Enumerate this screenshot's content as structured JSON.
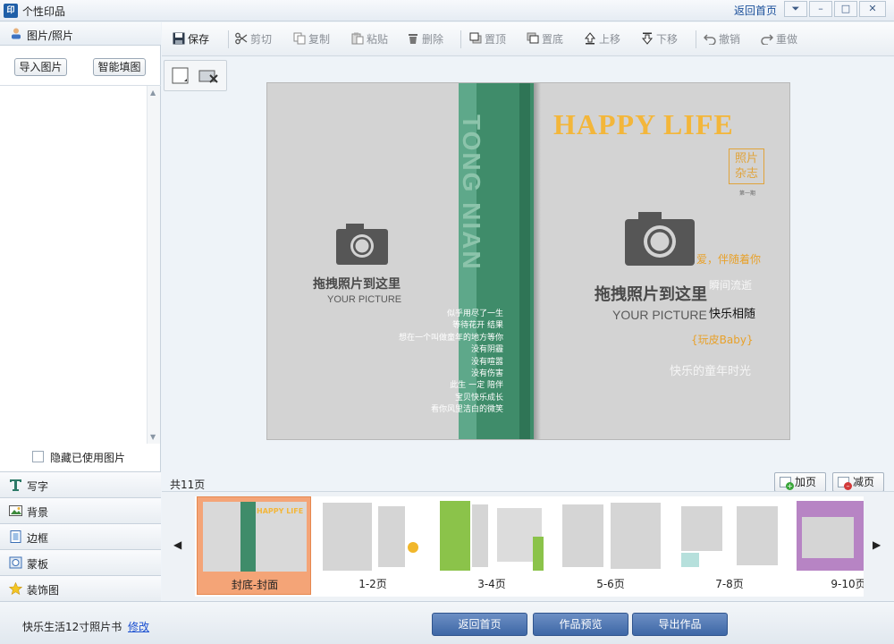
{
  "window": {
    "app_icon": "印",
    "title": "个性印品",
    "home_link": "返回首页",
    "controls": [
      "⏷",
      "–",
      "□",
      "✕"
    ]
  },
  "left_panel": {
    "header": "图片/照片",
    "import_button": "导入图片",
    "smart_fill_button": "智能填图",
    "hide_used_label": "隐藏已使用图片",
    "categories": [
      {
        "icon": "text-icon",
        "label": "写字"
      },
      {
        "icon": "background-icon",
        "label": "背景"
      },
      {
        "icon": "frame-icon",
        "label": "边框"
      },
      {
        "icon": "mask-icon",
        "label": "蒙板"
      },
      {
        "icon": "star-icon",
        "label": "装饰图"
      }
    ]
  },
  "toolbar": {
    "save": "保存",
    "cut": "剪切",
    "copy": "复制",
    "paste": "粘贴",
    "delete": "删除",
    "to_top": "置顶",
    "to_bottom": "置底",
    "move_up": "上移",
    "move_down": "下移",
    "undo": "撤销",
    "redo": "重做"
  },
  "canvas": {
    "spine_text": "TONG NIAN",
    "happy_life": "HAPPY  LIFE",
    "stamp": [
      "照片",
      "杂志"
    ],
    "stamp_sub": "第一期",
    "placeholder_title": "拖拽照片到这里",
    "placeholder_sub": "YOUR PICTURE",
    "poem": [
      "似乎用尽了一生",
      "等待花开  结果",
      "想在一个叫做童年的地方等你",
      "没有阴霾",
      "没有喧嚣",
      "没有伤害",
      "此生  一定  陪伴",
      "宝贝快乐成长",
      "看你风里洁白的微笑"
    ],
    "right_texts": {
      "love": "爱，伴随着你",
      "time": "瞬间流逝",
      "happy": "快乐相随",
      "baby": "{玩皮Baby}",
      "childhood": "快乐的童年时光"
    },
    "colors": {
      "spine": "#3f8c6a",
      "happy_life": "#f3b63a",
      "stamp": "#e0a33a",
      "love": "#e8a12a"
    }
  },
  "pages": {
    "count_label": "共11页",
    "add_label": "加页",
    "remove_label": "减页",
    "thumbnails": [
      {
        "label": "封底-封面",
        "selected": true
      },
      {
        "label": "1-2页",
        "selected": false
      },
      {
        "label": "3-4页",
        "selected": false
      },
      {
        "label": "5-6页",
        "selected": false
      },
      {
        "label": "7-8页",
        "selected": false
      },
      {
        "label": "9-10页",
        "selected": false
      }
    ],
    "prev_arrow": "◀",
    "next_arrow": "▶"
  },
  "bottom": {
    "project_name": "快乐生活12寸照片书",
    "edit_link": "修改",
    "home_button": "返回首页",
    "preview_button": "作品预览",
    "export_button": "导出作品"
  }
}
